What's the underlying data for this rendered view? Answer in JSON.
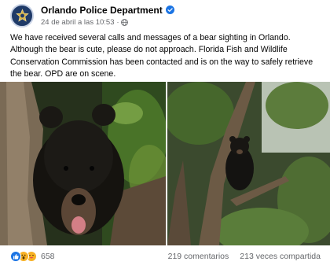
{
  "post": {
    "author": "Orlando Police Department",
    "timestamp": "24 de abril a las 10:53",
    "separator": "·",
    "privacy_icon": "globe-icon",
    "verified_icon": "verified-badge-icon",
    "text": "We have received several calls and messages of a bear sighting in Orlando. Although the bear is cute, please do not approach. Florida Fish and Wildlife Conservation Commission has been contacted and is on the way to safely retrieve the bear. OPD are on scene."
  },
  "photos": [
    {
      "icon": "photo-bear-closeup"
    },
    {
      "icon": "photo-bear-in-tree"
    }
  ],
  "engagement": {
    "reaction_icons": [
      "like-reaction-icon",
      "wow-reaction-icon",
      "love-reaction-icon"
    ],
    "reaction_count": "658",
    "comments": "219 comentarios",
    "shares": "213 veces compartida"
  },
  "colors": {
    "brand_blue": "#1b74e4",
    "secondary_text": "#65676b",
    "primary_text": "#050505"
  }
}
